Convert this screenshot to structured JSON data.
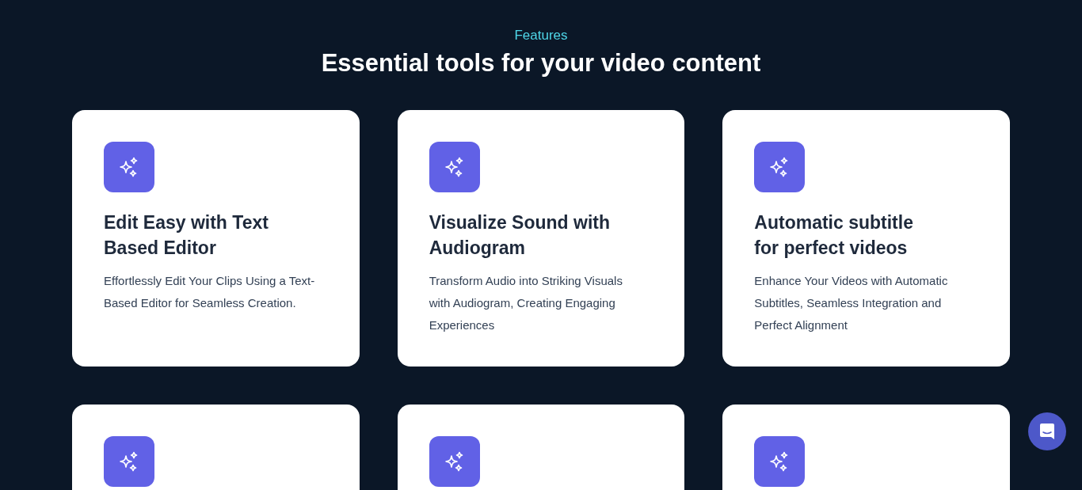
{
  "section": {
    "eyebrow": "Features",
    "heading": "Essential tools for your video content"
  },
  "cards": [
    {
      "kind": "full",
      "title": "Edit Easy with Text Based Editor",
      "description": "Effortlessly Edit Your Clips Using a Text-Based Editor for Seamless Creation."
    },
    {
      "kind": "full",
      "title": "Visualize Sound with Audiogram",
      "description": "Transform Audio into Striking Visuals with Audiogram, Creating Engaging Experiences"
    },
    {
      "kind": "full",
      "title": "Automatic subtitle for perfect videos",
      "description": "Enhance Your Videos with Automatic Subtitles, Seamless Integration and Perfect Alignment"
    },
    {
      "kind": "cut"
    },
    {
      "kind": "cut"
    },
    {
      "kind": "cut"
    }
  ]
}
